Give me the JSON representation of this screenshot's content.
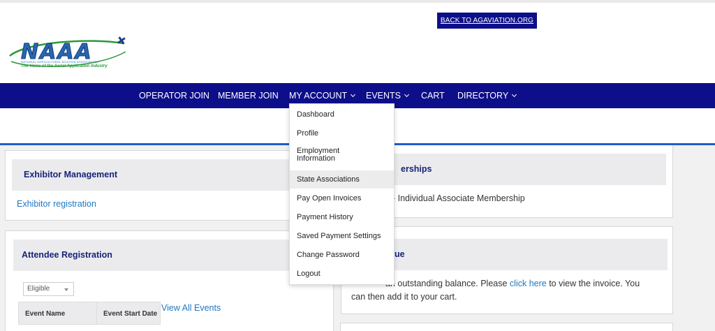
{
  "header": {
    "back_link": "BACK TO AGAVIATION.ORG",
    "logo": {
      "text": "NAAA",
      "subtitle": "NATIONAL AGRICULTURAL AVIATION ASSOCIATION",
      "tagline": "The Voice of the Aerial Application Industry"
    }
  },
  "nav": {
    "operator_join": "OPERATOR JOIN",
    "member_join": "MEMBER JOIN",
    "my_account": "MY ACCOUNT",
    "events": "EVENTS",
    "cart": "CART",
    "directory": "DIRECTORY"
  },
  "dropdown": {
    "items": [
      "Dashboard",
      "Profile",
      "Employment Information",
      "State Associations",
      "Pay Open Invoices",
      "Payment History",
      "Saved Payment Settings",
      "Change Password",
      "Logout"
    ],
    "active_index": 3
  },
  "exhibitor": {
    "title": "Exhibitor Management",
    "link": "Exhibitor registration"
  },
  "memberships": {
    "title_partial": "erships",
    "text_partial": "- Individual Associate Membership"
  },
  "attendee": {
    "title": "Attendee Registration",
    "filter_value": "Eligible",
    "view_all": "View All Events",
    "columns": [
      "Event Name",
      "Event Start Date"
    ]
  },
  "balance": {
    "title_partial": "ue",
    "text_before": "an outstanding balance. Please ",
    "link": "click here",
    "text_after": " to view the invoice. You",
    "line2": "can then add it to your cart."
  },
  "colors": {
    "nav_bg": "#0d0f8a",
    "accent_blue": "#1e5ccf",
    "link": "#1f78c1",
    "heading": "#17237a"
  }
}
